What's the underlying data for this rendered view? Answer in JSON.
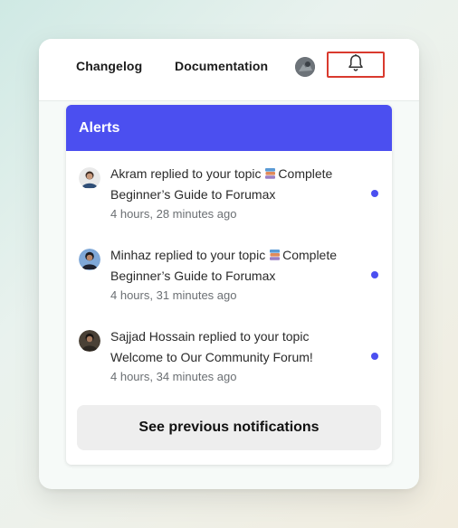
{
  "topbar": {
    "changelog": "Changelog",
    "documentation": "Documentation"
  },
  "alerts": {
    "title": "Alerts",
    "items": [
      {
        "line1": "Akram replied to your topic",
        "topic_icon": "books-icon",
        "topic_part1": "Complete",
        "line2": "Beginner’s Guide to Forumax",
        "time": "4 hours, 28 minutes ago",
        "unread": true
      },
      {
        "line1": "Minhaz replied to your topic",
        "topic_icon": "books-icon",
        "topic_part1": "Complete",
        "line2": "Beginner’s Guide to Forumax",
        "time": "4 hours, 31 minutes ago",
        "unread": true
      },
      {
        "line1": "Sajjad Hossain replied to your topic",
        "line2": "Welcome to Our Community Forum!",
        "time": "4 hours, 34 minutes ago",
        "unread": true
      }
    ],
    "see_previous": "See previous notifications"
  },
  "colors": {
    "accent": "#4b4ff0",
    "highlight_border": "#d93a2e"
  }
}
